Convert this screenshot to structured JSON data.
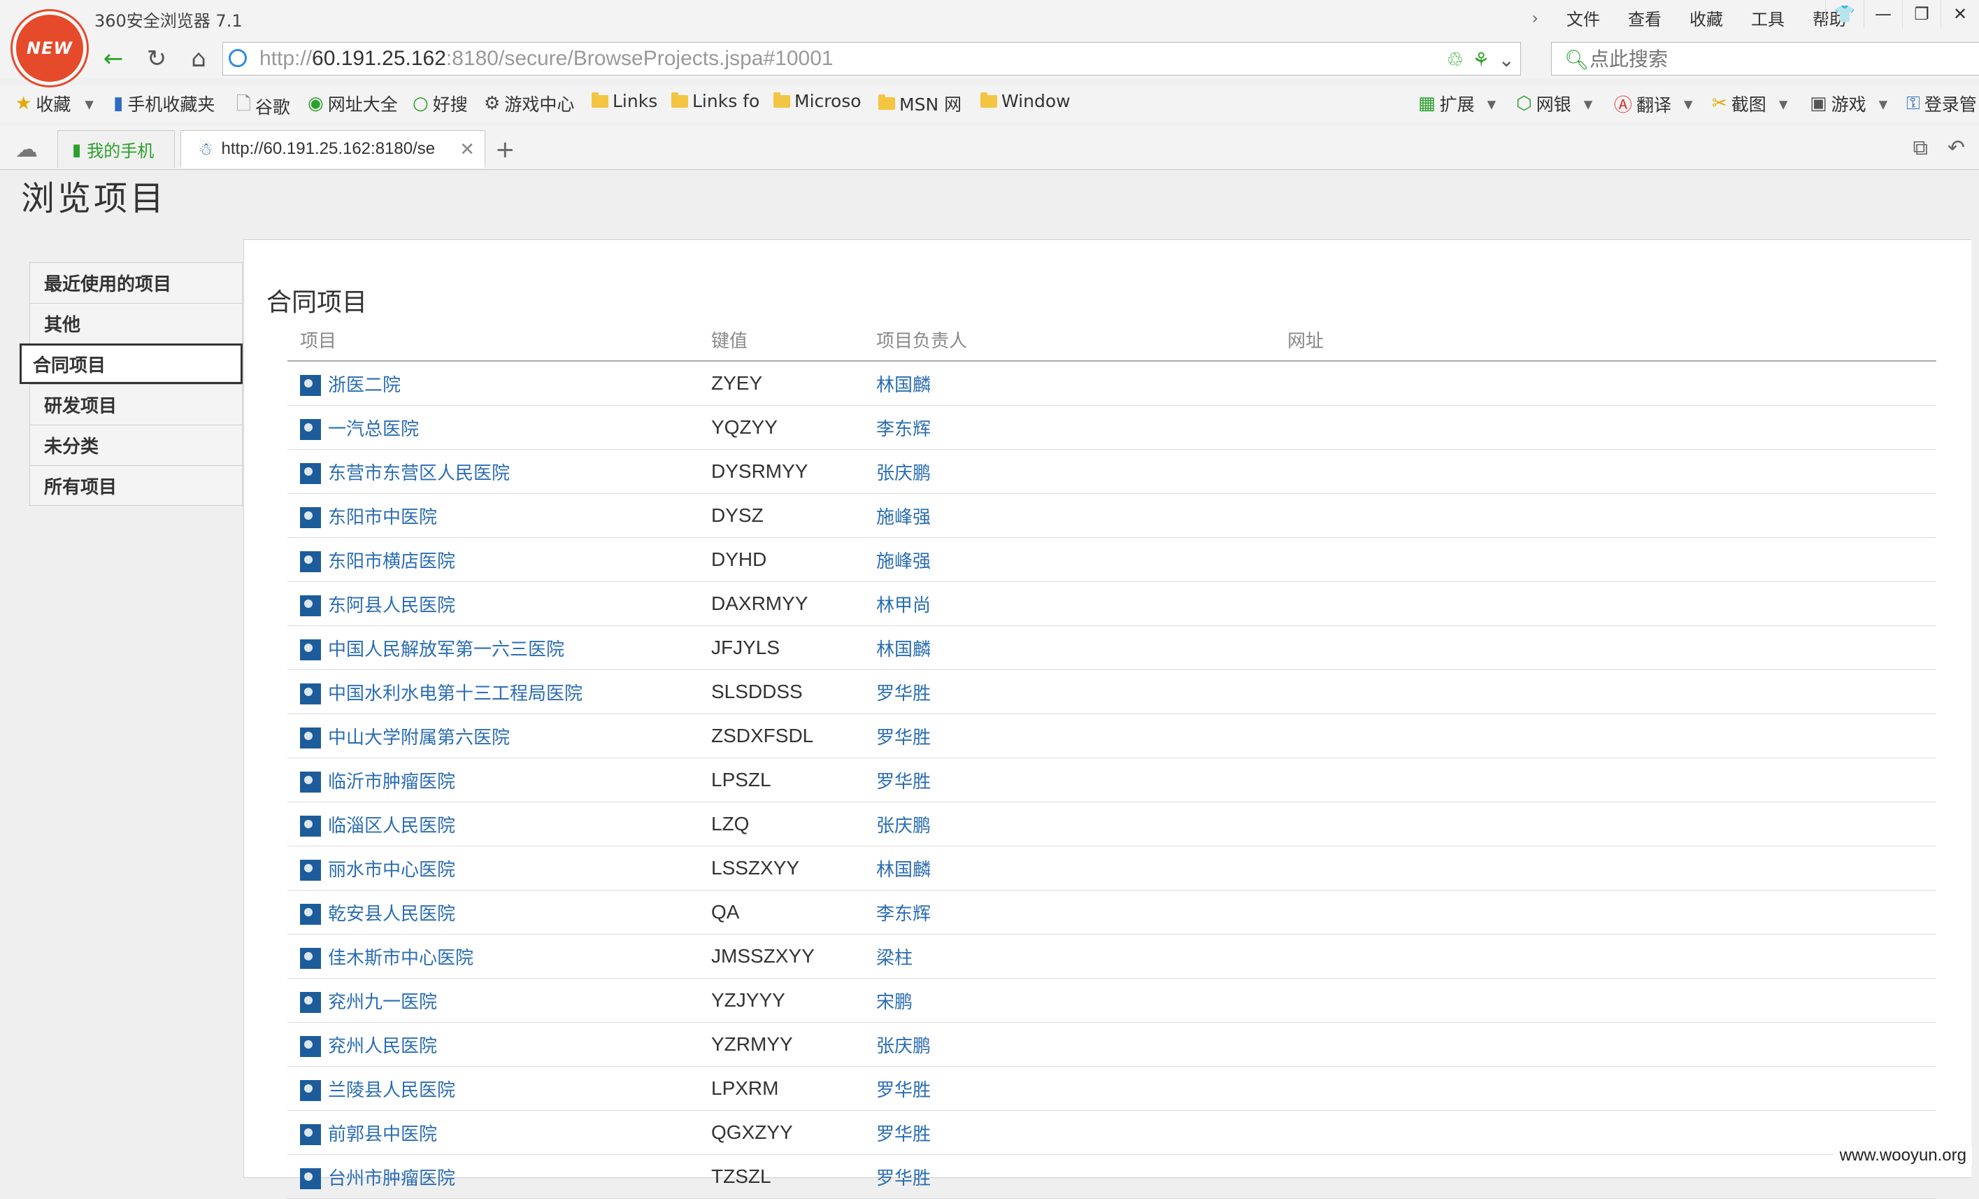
{
  "browser": {
    "logo_text": "NEW",
    "title": "360安全浏览器 7.1",
    "menu": [
      "文件",
      "查看",
      "收藏",
      "工具",
      "帮助"
    ],
    "url_dim_prefix": "http://",
    "url_host": "60.191.25.162",
    "url_rest": ":8180/secure/BrowseProjects.jspa#10001",
    "search_placeholder": "点此搜索",
    "bookmarks": [
      "收藏",
      "手机收藏夹",
      "谷歌",
      "网址大全",
      "好搜",
      "游戏中心",
      "Links",
      "Links fo",
      "Microso",
      "MSN 网",
      "Window"
    ],
    "extensions": [
      "扩展",
      "网银",
      "翻译",
      "截图",
      "游戏",
      "登录管"
    ],
    "tabs": [
      {
        "label": "我的手机"
      },
      {
        "label": "http://60.191.25.162:8180/se"
      }
    ]
  },
  "page": {
    "title": "浏览项目",
    "sidebar": [
      "最近使用的项目",
      "其他",
      "合同项目",
      "研发项目",
      "未分类",
      "所有项目"
    ],
    "active_sidebar": "合同项目",
    "section_title": "合同项目",
    "columns": [
      "项目",
      "键值",
      "项目负责人",
      "网址"
    ],
    "rows": [
      {
        "name": "浙医二院",
        "key": "ZYEY",
        "lead": "林国麟"
      },
      {
        "name": "一汽总医院",
        "key": "YQZYY",
        "lead": "李东辉"
      },
      {
        "name": "东营市东营区人民医院",
        "key": "DYSRMYY",
        "lead": "张庆鹏"
      },
      {
        "name": "东阳市中医院",
        "key": "DYSZ",
        "lead": "施峰强"
      },
      {
        "name": "东阳市横店医院",
        "key": "DYHD",
        "lead": "施峰强"
      },
      {
        "name": "东阿县人民医院",
        "key": "DAXRMYY",
        "lead": "林甲尚"
      },
      {
        "name": "中国人民解放军第一六三医院",
        "key": "JFJYLS",
        "lead": "林国麟"
      },
      {
        "name": "中国水利水电第十三工程局医院",
        "key": "SLSDDSS",
        "lead": "罗华胜"
      },
      {
        "name": "中山大学附属第六医院",
        "key": "ZSDXFSDL",
        "lead": "罗华胜"
      },
      {
        "name": "临沂市肿瘤医院",
        "key": "LPSZL",
        "lead": "罗华胜"
      },
      {
        "name": "临淄区人民医院",
        "key": "LZQ",
        "lead": "张庆鹏"
      },
      {
        "name": "丽水市中心医院",
        "key": "LSSZXYY",
        "lead": "林国麟"
      },
      {
        "name": "乾安县人民医院",
        "key": "QA",
        "lead": "李东辉"
      },
      {
        "name": "佳木斯市中心医院",
        "key": "JMSSZXYY",
        "lead": "梁柱"
      },
      {
        "name": "兖州九一医院",
        "key": "YZJYYY",
        "lead": "宋鹏"
      },
      {
        "name": "兖州人民医院",
        "key": "YZRMYY",
        "lead": "张庆鹏"
      },
      {
        "name": "兰陵县人民医院",
        "key": "LPXRM",
        "lead": "罗华胜"
      },
      {
        "name": "前郭县中医院",
        "key": "QGXZYY",
        "lead": "罗华胜"
      },
      {
        "name": "台州市肿瘤医院",
        "key": "TZSZL",
        "lead": "罗华胜"
      }
    ]
  },
  "watermark": "www.wooyun.org"
}
